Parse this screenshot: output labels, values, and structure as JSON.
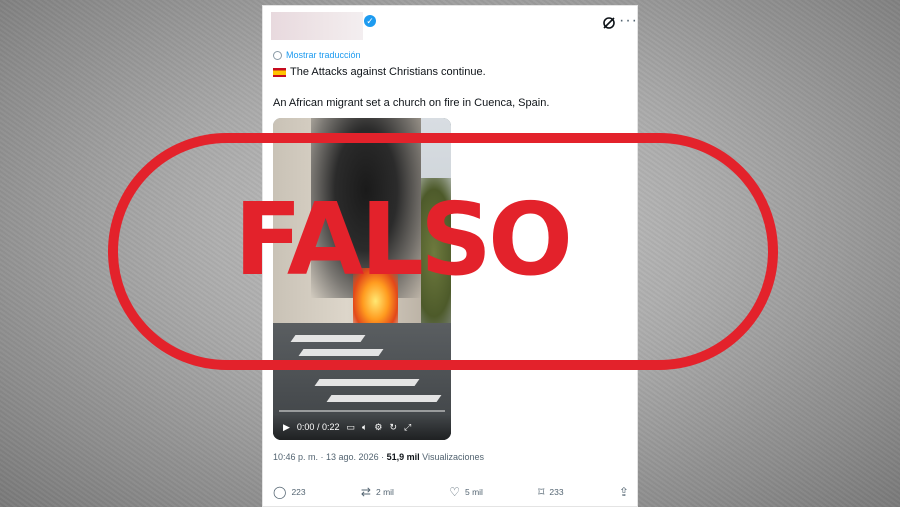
{
  "tweet": {
    "translate_link": "Mostrar traducción",
    "text_line1": "The Attacks against Christians continue.",
    "text_line2": "An African migrant set a church on fire in Cuenca, Spain.",
    "video": {
      "time": "0:00 / 0:22",
      "progress": 0
    },
    "meta_time": "10:46 p. m. · 13 ago. 2026 ·",
    "meta_views_count": "51,9 mil",
    "meta_views_label": "Visualizaciones",
    "actions": {
      "replies": "223",
      "reposts": "2 mil",
      "likes": "5 mil",
      "bookmarks": "233"
    }
  },
  "stamp": {
    "label": "FALSO",
    "color": "#e3222b"
  },
  "colors": {
    "link": "#1d9bf0",
    "muted": "#536471"
  }
}
